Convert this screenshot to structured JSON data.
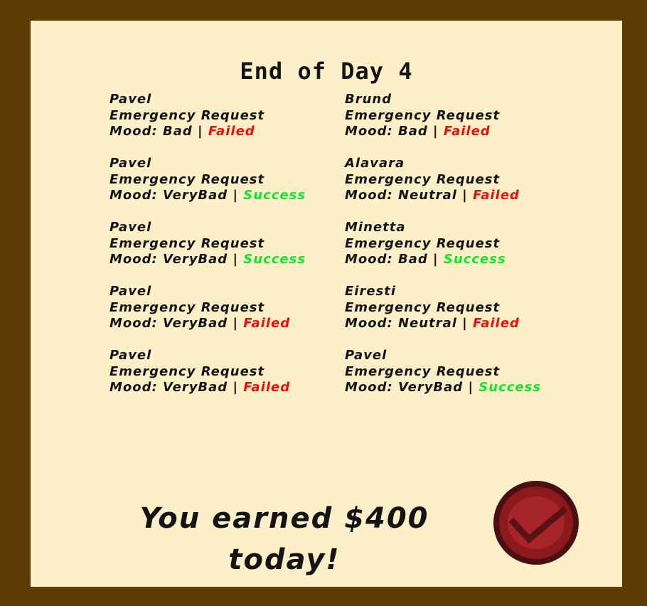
{
  "title": "End of Day 4",
  "entries_left": [
    {
      "name": "Pavel",
      "request": "Emergency Request",
      "mood_prefix": "Mood: Bad | ",
      "result": "Failed",
      "status": "failed"
    },
    {
      "name": "Pavel",
      "request": "Emergency Request",
      "mood_prefix": "Mood: VeryBad | ",
      "result": "Success",
      "status": "success"
    },
    {
      "name": "Pavel",
      "request": "Emergency Request",
      "mood_prefix": "Mood: VeryBad | ",
      "result": "Success",
      "status": "success"
    },
    {
      "name": "Pavel",
      "request": "Emergency Request",
      "mood_prefix": "Mood: VeryBad | ",
      "result": "Failed",
      "status": "failed"
    },
    {
      "name": "Pavel",
      "request": "Emergency Request",
      "mood_prefix": "Mood: VeryBad | ",
      "result": "Failed",
      "status": "failed"
    }
  ],
  "entries_right": [
    {
      "name": "Brund",
      "request": "Emergency Request",
      "mood_prefix": "Mood: Bad | ",
      "result": "Failed",
      "status": "failed"
    },
    {
      "name": "Alavara",
      "request": "Emergency Request",
      "mood_prefix": "Mood: Neutral | ",
      "result": "Failed",
      "status": "failed"
    },
    {
      "name": "Minetta",
      "request": "Emergency Request",
      "mood_prefix": "Mood: Bad | ",
      "result": "Success",
      "status": "success"
    },
    {
      "name": "Eiresti",
      "request": "Emergency Request",
      "mood_prefix": "Mood: Neutral | ",
      "result": "Failed",
      "status": "failed"
    },
    {
      "name": "Pavel",
      "request": "Emergency Request",
      "mood_prefix": "Mood: VeryBad | ",
      "result": "Success",
      "status": "success"
    }
  ],
  "earnings": {
    "line1": "You earned $400",
    "line2": "today!"
  },
  "confirm_button": {
    "icon": "checkmark-icon"
  },
  "colors": {
    "frame": "#5c3c03",
    "panel": "#fdf0c9",
    "text": "#141414",
    "failed": "#f10c0c",
    "success": "#10e52c",
    "button": "#8c1a1c"
  }
}
